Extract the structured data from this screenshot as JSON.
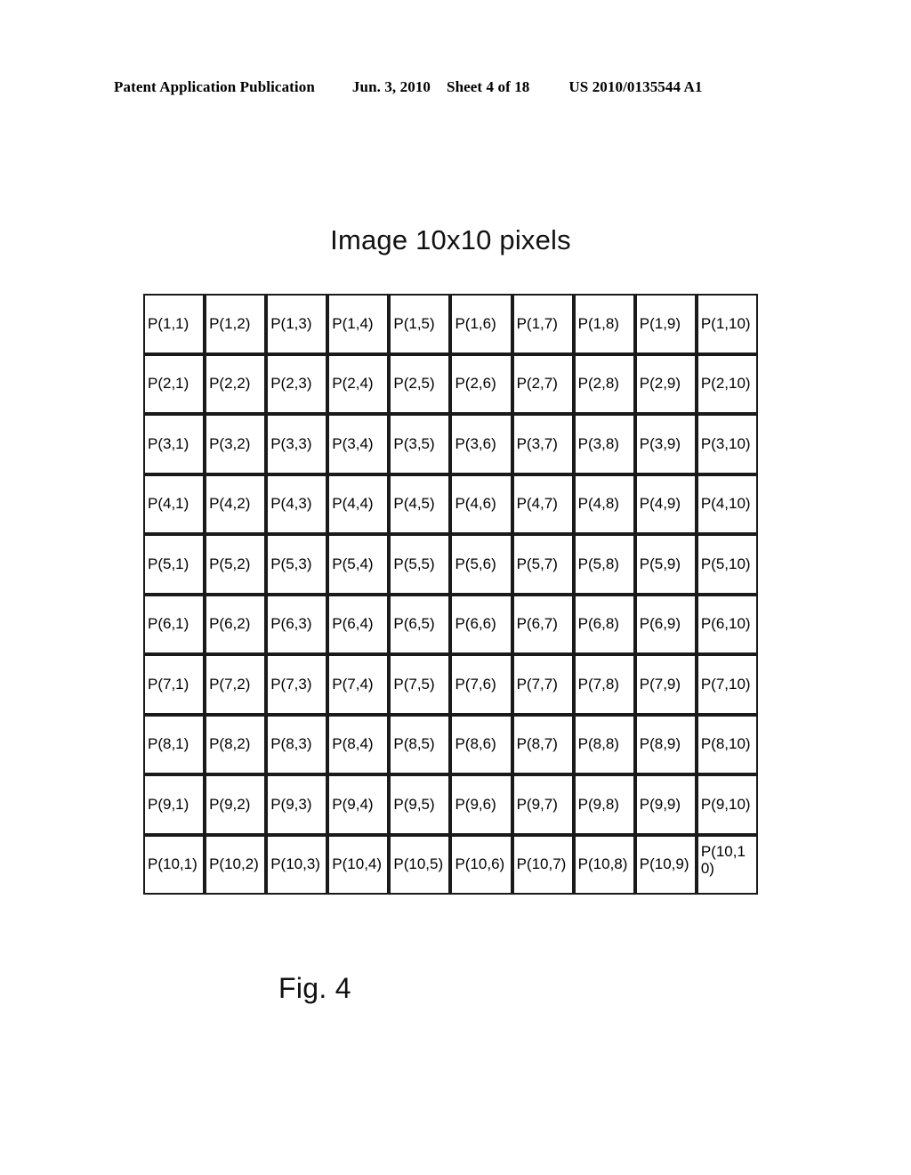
{
  "header": {
    "publication": "Patent Application Publication",
    "date": "Jun. 3, 2010",
    "sheet": "Sheet 4 of 18",
    "doc_number": "US 2010/0135544 A1"
  },
  "figure": {
    "title": "Image 10x10 pixels",
    "caption": "Fig. 4",
    "grid": {
      "rows": 10,
      "cols": 10,
      "cells": [
        [
          "P(1,1)",
          "P(1,2)",
          "P(1,3)",
          "P(1,4)",
          "P(1,5)",
          "P(1,6)",
          "P(1,7)",
          "P(1,8)",
          "P(1,9)",
          "P(1,10)"
        ],
        [
          "P(2,1)",
          "P(2,2)",
          "P(2,3)",
          "P(2,4)",
          "P(2,5)",
          "P(2,6)",
          "P(2,7)",
          "P(2,8)",
          "P(2,9)",
          "P(2,10)"
        ],
        [
          "P(3,1)",
          "P(3,2)",
          "P(3,3)",
          "P(3,4)",
          "P(3,5)",
          "P(3,6)",
          "P(3,7)",
          "P(3,8)",
          "P(3,9)",
          "P(3,10)"
        ],
        [
          "P(4,1)",
          "P(4,2)",
          "P(4,3)",
          "P(4,4)",
          "P(4,5)",
          "P(4,6)",
          "P(4,7)",
          "P(4,8)",
          "P(4,9)",
          "P(4,10)"
        ],
        [
          "P(5,1)",
          "P(5,2)",
          "P(5,3)",
          "P(5,4)",
          "P(5,5)",
          "P(5,6)",
          "P(5,7)",
          "P(5,8)",
          "P(5,9)",
          "P(5,10)"
        ],
        [
          "P(6,1)",
          "P(6,2)",
          "P(6,3)",
          "P(6,4)",
          "P(6,5)",
          "P(6,6)",
          "P(6,7)",
          "P(6,8)",
          "P(6,9)",
          "P(6,10)"
        ],
        [
          "P(7,1)",
          "P(7,2)",
          "P(7,3)",
          "P(7,4)",
          "P(7,5)",
          "P(7,6)",
          "P(7,7)",
          "P(7,8)",
          "P(7,9)",
          "P(7,10)"
        ],
        [
          "P(8,1)",
          "P(8,2)",
          "P(8,3)",
          "P(8,4)",
          "P(8,5)",
          "P(8,6)",
          "P(8,7)",
          "P(8,8)",
          "P(8,9)",
          "P(8,10)"
        ],
        [
          "P(9,1)",
          "P(9,2)",
          "P(9,3)",
          "P(9,4)",
          "P(9,5)",
          "P(9,6)",
          "P(9,7)",
          "P(9,8)",
          "P(9,9)",
          "P(9,10)"
        ],
        [
          "P(10,1)",
          "P(10,2)",
          "P(10,3)",
          "P(10,4)",
          "P(10,5)",
          "P(10,6)",
          "P(10,7)",
          "P(10,8)",
          "P(10,9)",
          "P(10,10)"
        ]
      ]
    }
  },
  "colors": {
    "page_background": "#ffffff",
    "ink": "#000000",
    "cell_border": "#1a1a1a"
  }
}
